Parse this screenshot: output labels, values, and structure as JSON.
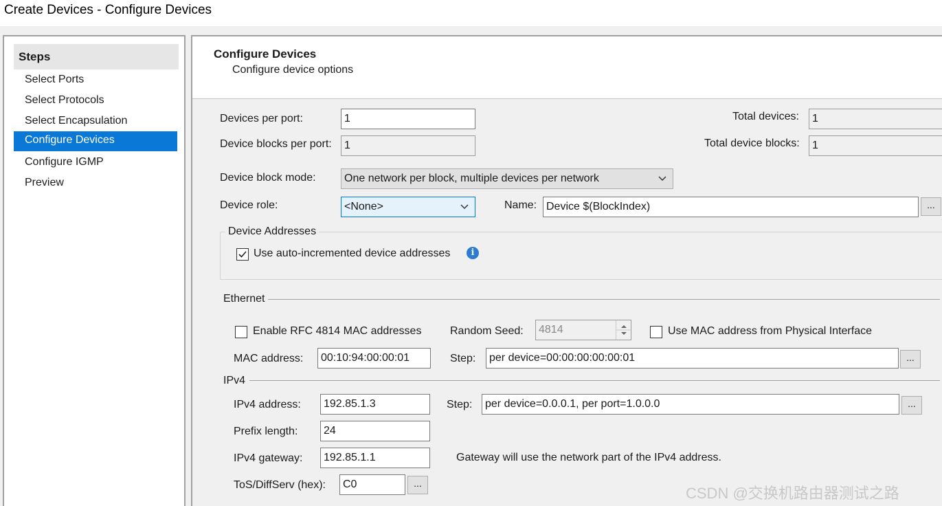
{
  "window": {
    "title": "Create Devices - Configure Devices"
  },
  "sidebar": {
    "header": "Steps",
    "items": [
      {
        "label": "Select Ports"
      },
      {
        "label": "Select Protocols"
      },
      {
        "label": "Select Encapsulation"
      },
      {
        "label": "Configure Devices"
      },
      {
        "label": "Configure IGMP"
      },
      {
        "label": "Preview"
      }
    ],
    "active_index": 3
  },
  "main": {
    "title": "Configure Devices",
    "subtitle": "Configure device options"
  },
  "form": {
    "devices_per_port_label": "Devices per port:",
    "devices_per_port_value": "1",
    "device_blocks_per_port_label": "Device blocks per port:",
    "device_blocks_per_port_value": "1",
    "total_devices_label": "Total devices:",
    "total_devices_value": "1",
    "total_device_blocks_label": "Total device blocks:",
    "total_device_blocks_value": "1",
    "device_block_mode_label": "Device block mode:",
    "device_block_mode_value": "One network per block, multiple devices per network",
    "device_role_label": "Device role:",
    "device_role_value": "<None>",
    "name_label": "Name:",
    "name_value": "Device $(BlockIndex)",
    "ellipsis": "..."
  },
  "device_addresses": {
    "group_label": "Device Addresses",
    "auto_increment_label": "Use auto-incremented device addresses",
    "auto_increment_checked": true
  },
  "ethernet": {
    "group_label": "Ethernet",
    "rfc4814_label": "Enable RFC 4814 MAC addresses",
    "random_seed_label": "Random Seed:",
    "random_seed_value": "4814",
    "use_mac_physical_label": "Use MAC address from Physical Interface",
    "mac_address_label": "MAC address:",
    "mac_address_value": "00:10:94:00:00:01",
    "step_label": "Step:",
    "step_value": "per device=00:00:00:00:00:01"
  },
  "ipv4": {
    "group_label": "IPv4",
    "address_label": "IPv4 address:",
    "address_value": "192.85.1.3",
    "step_label": "Step:",
    "step_value": "per device=0.0.0.1, per port=1.0.0.0",
    "prefix_label": "Prefix length:",
    "prefix_value": "24",
    "gateway_label": "IPv4 gateway:",
    "gateway_value": "192.85.1.1",
    "gateway_note": "Gateway will use the network part of the IPv4 address.",
    "tos_label": "ToS/DiffServ (hex):",
    "tos_value": "C0"
  },
  "watermark": "CSDN @交换机路由器测试之路",
  "colors": {
    "accent": "#0a78d7",
    "info": "#2a7bd2"
  }
}
